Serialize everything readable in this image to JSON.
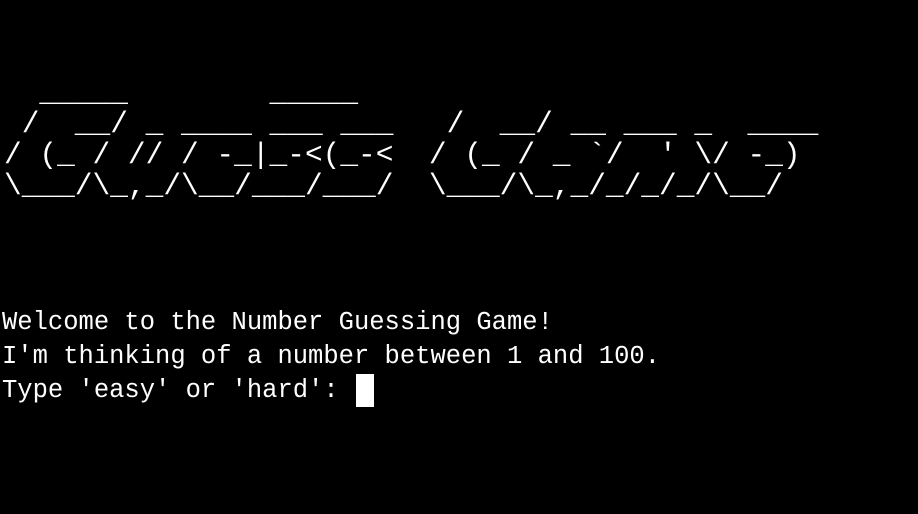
{
  "terminal": {
    "background": "#000000",
    "foreground": "#ffffff",
    "banner_lines": [
      "  _____        _____",
      " /  __/ _ ____ ___ ___   /  __/ __ ___ _  ____",
      "/ (_ / // / -_|_-<(_-<  / (_ / _ `/  ' \\/ -_)",
      "\\___/\\_,_/\\__/___/___/  \\___/\\_,_/_/_/_/\\__/"
    ],
    "messages": [
      "Welcome to the Number Guessing Game!",
      "I'm thinking of a number between 1 and 100."
    ],
    "prompt": "Type 'easy' or 'hard': ",
    "input_value": ""
  }
}
